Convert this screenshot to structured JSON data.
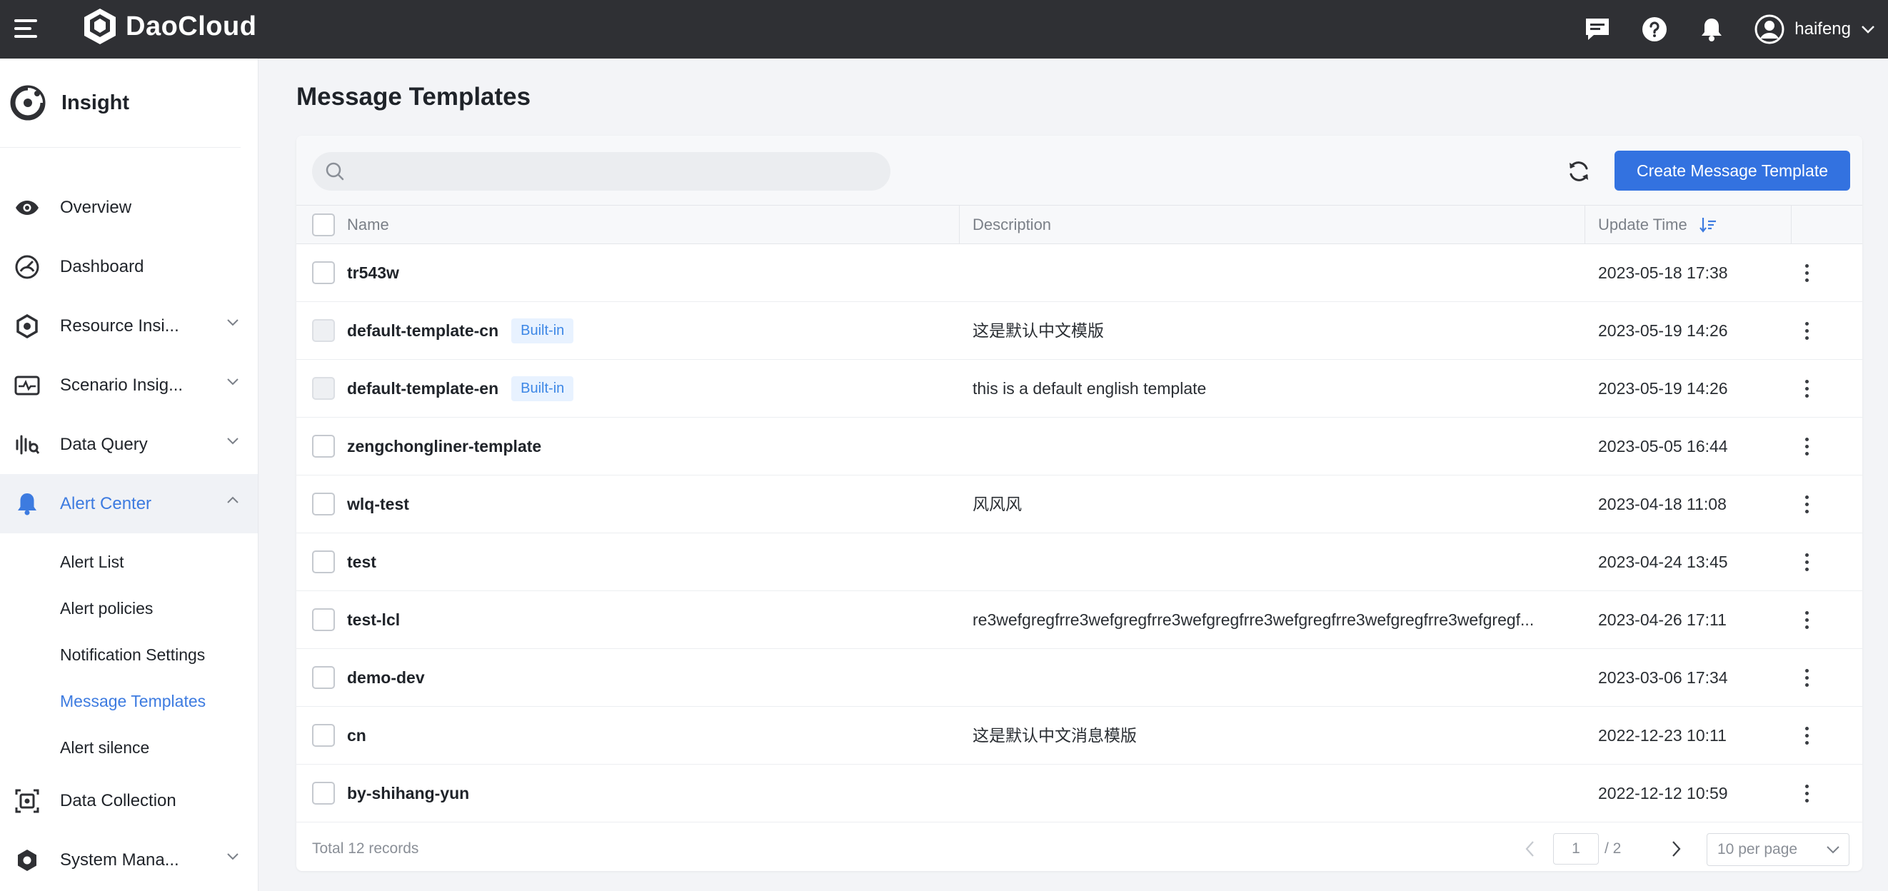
{
  "topbar": {
    "brand": "DaoCloud",
    "user_name": "haifeng"
  },
  "sidebar": {
    "title": "Insight",
    "items": [
      {
        "label": "Overview"
      },
      {
        "label": "Dashboard"
      },
      {
        "label": "Resource Insi..."
      },
      {
        "label": "Scenario Insig..."
      },
      {
        "label": "Data Query"
      },
      {
        "label": "Alert Center"
      },
      {
        "label": "Data Collection"
      },
      {
        "label": "System Mana..."
      }
    ],
    "alert_sub_items": [
      {
        "label": "Alert List"
      },
      {
        "label": "Alert policies"
      },
      {
        "label": "Notification Settings"
      },
      {
        "label": "Message Templates"
      },
      {
        "label": "Alert silence"
      }
    ]
  },
  "page": {
    "title": "Message Templates",
    "search_placeholder": "",
    "create_label": "Create Message Template"
  },
  "table": {
    "columns": {
      "name": "Name",
      "description": "Description",
      "update_time": "Update Time"
    },
    "rows": [
      {
        "name": "tr543w",
        "badge": "",
        "description": "",
        "time": "2023-05-18 17:38"
      },
      {
        "name": "default-template-cn",
        "badge": "Built-in",
        "description": "这是默认中文模版",
        "time": "2023-05-19 14:26"
      },
      {
        "name": "default-template-en",
        "badge": "Built-in",
        "description": "this is a default english template",
        "time": "2023-05-19 14:26"
      },
      {
        "name": "zengchongliner-template",
        "badge": "",
        "description": "",
        "time": "2023-05-05 16:44"
      },
      {
        "name": "wlq-test",
        "badge": "",
        "description": "风风风",
        "time": "2023-04-18 11:08"
      },
      {
        "name": "test",
        "badge": "",
        "description": "",
        "time": "2023-04-24 13:45"
      },
      {
        "name": "test-lcl",
        "badge": "",
        "description": "re3wefgregfrre3wefgregfrre3wefgregfrre3wefgregfrre3wefgregfrre3wefgregf...",
        "time": "2023-04-26 17:11"
      },
      {
        "name": "demo-dev",
        "badge": "",
        "description": "",
        "time": "2023-03-06 17:34"
      },
      {
        "name": "cn",
        "badge": "",
        "description": "这是默认中文消息模版",
        "time": "2022-12-23 10:11"
      },
      {
        "name": "by-shihang-yun",
        "badge": "",
        "description": "",
        "time": "2022-12-12 10:59"
      }
    ]
  },
  "footer": {
    "total": "Total 12 records",
    "page_current": "1",
    "page_total": "/ 2",
    "per_page": "10 per page"
  },
  "colors": {
    "topbar": "#2f3034",
    "accent": "#3372e0",
    "badge_bg": "#e8f2ff",
    "badge_text": "#3d87e6"
  }
}
